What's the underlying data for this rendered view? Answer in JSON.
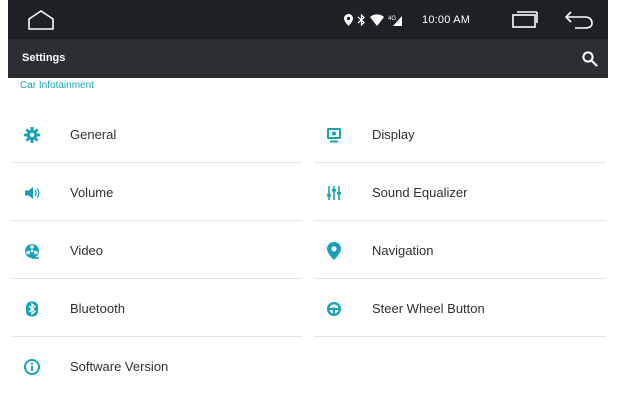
{
  "system_bar": {
    "time": "10:00 AM"
  },
  "app_bar": {
    "title": "Settings"
  },
  "section": {
    "label": "Car Infotainment"
  },
  "items": [
    {
      "label": "General",
      "icon": "gear-icon"
    },
    {
      "label": "Display",
      "icon": "display-icon"
    },
    {
      "label": "Volume",
      "icon": "speaker-icon"
    },
    {
      "label": "Sound Equalizer",
      "icon": "equalizer-icon"
    },
    {
      "label": "Video",
      "icon": "film-reel-icon"
    },
    {
      "label": "Navigation",
      "icon": "location-pin-icon"
    },
    {
      "label": "Bluetooth",
      "icon": "bluetooth-icon"
    },
    {
      "label": "Steer Wheel Button",
      "icon": "steering-wheel-icon"
    },
    {
      "label": "Software Version",
      "icon": "info-icon"
    }
  ],
  "colors": {
    "accent": "#18a2b8",
    "status_bar": "#1d2125",
    "app_bar": "#2b2f33"
  }
}
